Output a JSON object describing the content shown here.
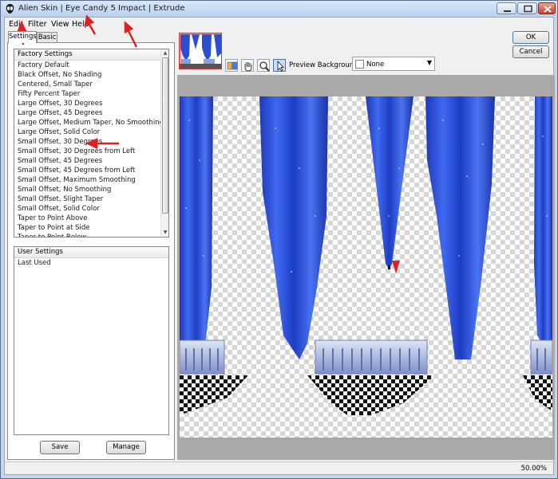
{
  "window": {
    "title": "Alien Skin | Eye Candy 5 Impact | Extrude",
    "minimize_icon": "minimize-icon",
    "maximize_icon": "maximize-icon",
    "close_icon": "close-icon"
  },
  "menubar": {
    "items": [
      "Edit",
      "Filter",
      "View",
      "Help"
    ]
  },
  "tabs": {
    "settings": "Settings",
    "basic": "Basic"
  },
  "factory_settings": {
    "header": "Factory Settings",
    "items": [
      "Factory Default",
      "Black Offset, No Shading",
      "Centered, Small Taper",
      "Fifty Percent Taper",
      "Large Offset, 30 Degrees",
      "Large Offset, 45 Degrees",
      "Large Offset, Medium Taper, No Smoothing",
      "Large Offset, Solid Color",
      "Small Offset, 30 Degrees",
      "Small Offset, 30 Degrees from Left",
      "Small Offset, 45 Degrees",
      "Small Offset, 45 Degrees from Left",
      "Small Offset, Maximum Smoothing",
      "Small Offset, No Smoothing",
      "Small Offset, Slight Taper",
      "Small Offset, Solid Color",
      "Taper to Point Above",
      "Taper to Point at Side",
      "Taper to Point Below"
    ]
  },
  "user_settings": {
    "header": "User Settings",
    "items": [
      "Last Used"
    ]
  },
  "buttons": {
    "save": "Save",
    "manage": "Manage",
    "ok": "OK",
    "cancel": "Cancel"
  },
  "toolbar": {
    "tools": [
      "preview-toggle-icon",
      "hand-pan-icon",
      "zoom-magnifier-icon",
      "arrow-pointer-icon"
    ],
    "preview_background_label": "Preview Background:",
    "preview_background_value": "None"
  },
  "status": {
    "zoom": "50.00%"
  },
  "colors": {
    "accent_red": "#e02020",
    "curtain_blue": "#2a4fd6",
    "selection_blue": "#c9defa"
  }
}
